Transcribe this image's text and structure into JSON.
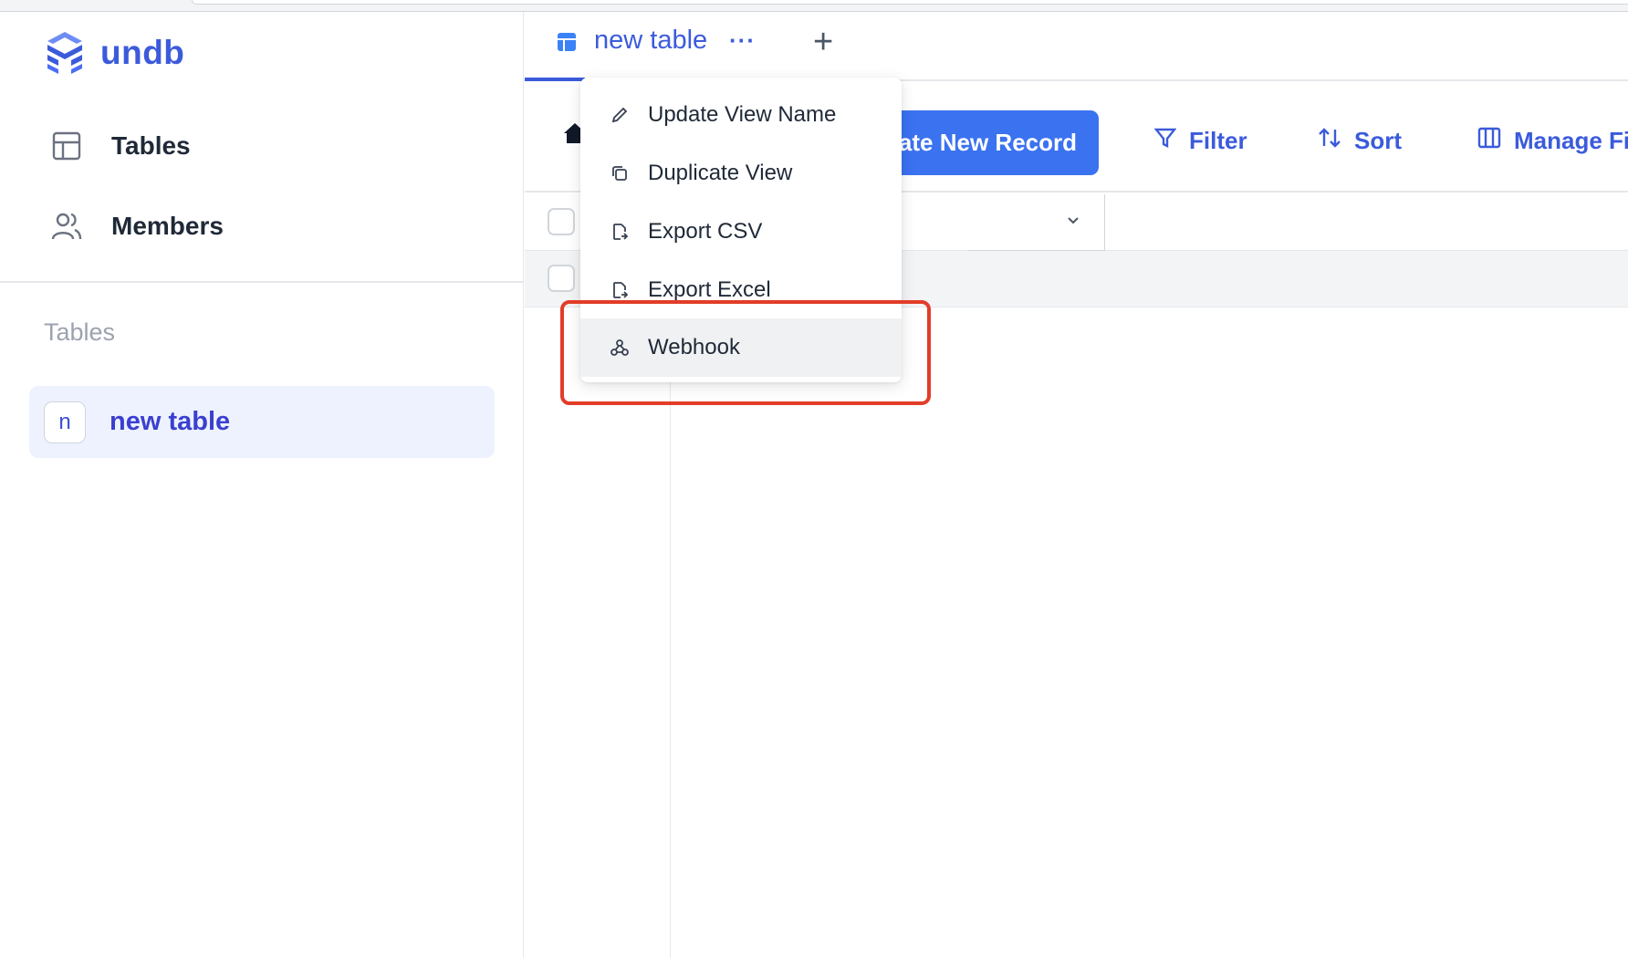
{
  "app": {
    "name": "undb"
  },
  "sidebar": {
    "nav": [
      {
        "label": "Tables",
        "icon": "table-icon"
      },
      {
        "label": "Members",
        "icon": "users-icon"
      }
    ],
    "section_label": "Tables",
    "tables": [
      {
        "avatar": "n",
        "label": "new table"
      }
    ]
  },
  "tabs": [
    {
      "label": "new table",
      "more": "···"
    }
  ],
  "add_tab_label": "+",
  "toolbar": {
    "create_button": "Create New Record",
    "filter": "Filter",
    "sort": "Sort",
    "manage_fields": "Manage Fields"
  },
  "view_menu": {
    "items": [
      {
        "label": "Update View Name",
        "icon": "pencil-icon"
      },
      {
        "label": "Duplicate View",
        "icon": "copy-icon"
      },
      {
        "label": "Export CSV",
        "icon": "file-export-icon"
      },
      {
        "label": "Export Excel",
        "icon": "file-export-icon"
      },
      {
        "label": "Webhook",
        "icon": "webhook-icon",
        "hovered": true
      }
    ]
  },
  "colors": {
    "brand": "#3b5bdb",
    "primary_button": "#3b72f0",
    "selected_table_bg": "#edf2fe",
    "highlight_box": "#e23d28"
  }
}
